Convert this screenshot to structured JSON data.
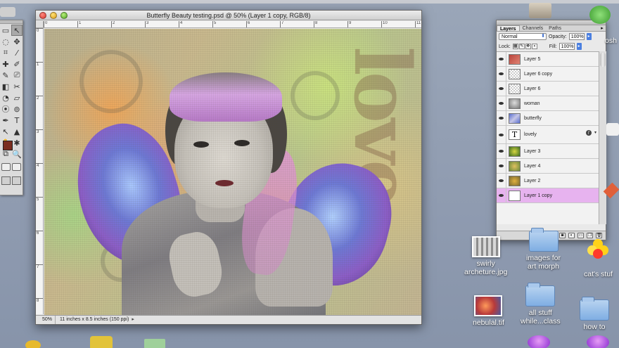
{
  "document": {
    "title": "Butterfly Beauty testing.psd @ 50% (Layer 1 copy, RGB/8)",
    "zoom": "50%",
    "doc_info": "11 inches x 8.5 inches (150 ppi)",
    "ruler_h": [
      "0",
      "1",
      "2",
      "3",
      "4",
      "5",
      "6",
      "7",
      "8",
      "9",
      "10",
      "11"
    ],
    "ruler_v": [
      "0",
      "1",
      "2",
      "3",
      "4",
      "5",
      "6",
      "7",
      "8"
    ],
    "canvas_text": "love"
  },
  "tools": {
    "items": [
      "▭",
      "↖",
      "◌",
      "✥",
      "⌗",
      "⁄",
      "✚",
      "✐",
      "✎",
      "⎚",
      "◧",
      "✂",
      "◔",
      "▱",
      "⦿",
      "⊚",
      "✒",
      "T",
      "↖",
      "▲",
      "✋",
      "✱",
      "⧉",
      "🔍"
    ]
  },
  "layers_panel": {
    "tabs": [
      "Layers",
      "Channels",
      "Paths"
    ],
    "blend_mode": "Normal",
    "opacity_label": "Opacity:",
    "opacity_value": "100%",
    "lock_label": "Lock:",
    "fill_label": "Fill:",
    "fill_value": "100%",
    "layers": [
      {
        "name": "Layer 5",
        "thumb": "red",
        "selected": false
      },
      {
        "name": "Layer 6 copy",
        "thumb": "checker",
        "selected": false
      },
      {
        "name": "Layer 6",
        "thumb": "checker",
        "selected": false
      },
      {
        "name": "woman",
        "thumb": "woman",
        "selected": false
      },
      {
        "name": "butterfly",
        "thumb": "butterfly",
        "selected": false
      },
      {
        "name": "lovely",
        "thumb": "text",
        "thumb_text": "T",
        "selected": false,
        "fx": true
      },
      {
        "name": "Layer 3",
        "thumb": "green",
        "selected": false
      },
      {
        "name": "Layer 4",
        "thumb": "green2",
        "selected": false
      },
      {
        "name": "Layer 2",
        "thumb": "gold",
        "selected": false
      },
      {
        "name": "Layer 1 copy",
        "thumb": "blank",
        "selected": true
      }
    ]
  },
  "desktop": {
    "items": [
      {
        "label_lines": [
          "swirly",
          "archeture.jpg"
        ],
        "kind": "image"
      },
      {
        "label_lines": [
          "images for",
          "art morph"
        ],
        "kind": "folder"
      },
      {
        "label_lines": [
          "cat's stuf"
        ],
        "kind": "balls"
      },
      {
        "label_lines": [
          "nebulal.tif"
        ],
        "kind": "image2"
      },
      {
        "label_lines": [
          "all stuff",
          "while...class"
        ],
        "kind": "folder"
      },
      {
        "label_lines": [
          "how to"
        ],
        "kind": "folder"
      },
      {
        "label_lines": [
          "osh"
        ],
        "kind": "partial"
      }
    ]
  },
  "colors": {
    "foreground_swatch": "#7a2d1f",
    "selected_layer": "#e7b3ef",
    "desktop": "#8f9bb0"
  }
}
